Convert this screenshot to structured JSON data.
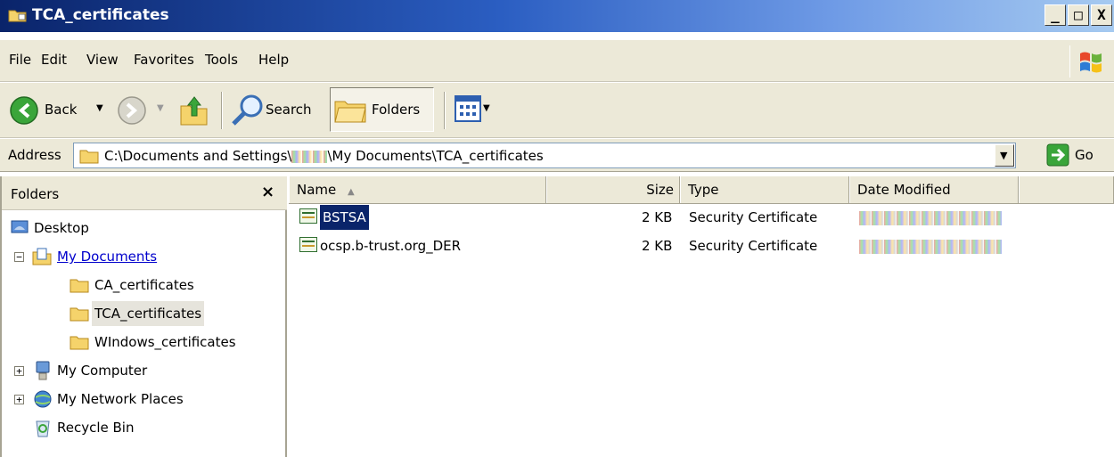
{
  "window": {
    "title": "TCA_certificates"
  },
  "window_buttons": [
    "_",
    "□",
    "X"
  ],
  "menubar": {
    "items": [
      "File",
      "Edit",
      "View",
      "Favorites",
      "Tools",
      "Help"
    ]
  },
  "toolbar": {
    "back": "Back",
    "search": "Search",
    "folders": "Folders"
  },
  "address": {
    "label": "Address",
    "path_start": "C:\\Documents and Settings\\",
    "path_end": "\\My Documents\\TCA_certificates",
    "go": "Go"
  },
  "folders_pane": {
    "title": "Folders",
    "close": "×",
    "items": [
      {
        "label": "Desktop",
        "icon": "desktop-icon"
      },
      {
        "label": "My Documents",
        "icon": "my-documents-icon",
        "expanded": true
      },
      {
        "label": "CA_certificates",
        "icon": "folder-icon"
      },
      {
        "label": "TCA_certificates",
        "icon": "folder-icon",
        "selected": true
      },
      {
        "label": "WIndows_certificates",
        "icon": "folder-icon"
      },
      {
        "label": "My Computer",
        "icon": "my-computer-icon"
      },
      {
        "label": "My Network Places",
        "icon": "network-places-icon"
      },
      {
        "label": "Recycle Bin",
        "icon": "recycle-bin-icon"
      }
    ]
  },
  "file_list": {
    "columns": [
      "Name",
      "Size",
      "Type",
      "Date Modified"
    ],
    "sort_indicator": "▲",
    "rows": [
      {
        "name": "BSTSA",
        "size": "2 KB",
        "type": "Security Certificate",
        "selected": true
      },
      {
        "name": "ocsp.b-trust.org_DER",
        "size": "2 KB",
        "type": "Security Certificate",
        "selected": false
      }
    ]
  },
  "colors": {
    "titlebar_start": "#0a246a",
    "chrome": "#ece9d8",
    "selection": "#0a246a"
  }
}
